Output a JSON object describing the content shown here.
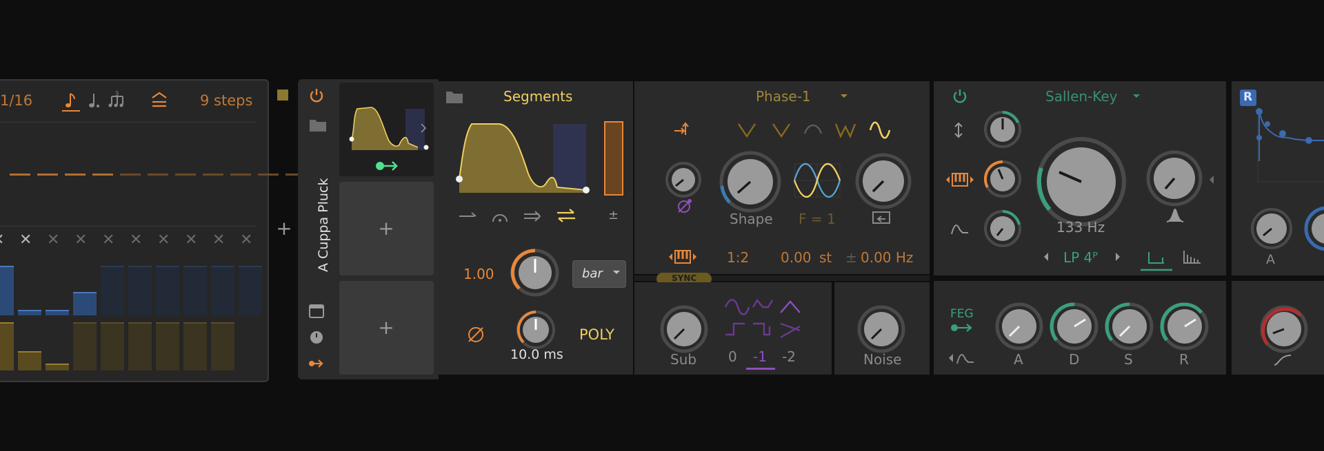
{
  "sequencer": {
    "rate": "1/16",
    "steps": "9 steps",
    "x_marks": [
      "✕",
      "✕",
      "✕",
      "✕",
      "✕",
      "✕",
      "✕",
      "✕",
      "✕",
      "✕"
    ]
  },
  "device_chain": {
    "add_label": "+",
    "device_name": "A Cuppa Pluck",
    "slot_add_1": "+",
    "slot_add_2": "+"
  },
  "segments": {
    "title": "Segments",
    "amount": "1.00",
    "mode": "bar",
    "time": "10.0 ms",
    "poly": "POLY",
    "bipolar": "±"
  },
  "phase1": {
    "title": "Phase-1",
    "shape_label": "Shape",
    "f_label": "F = 1",
    "ratio": "1:2",
    "semitones": "0.00",
    "st_unit": "st",
    "pm": "±",
    "hz": "0.00 Hz",
    "sync": "SYNC",
    "sub_label": "Sub",
    "oct": [
      "0",
      "-1",
      "-2"
    ],
    "noise_label": "Noise"
  },
  "filter": {
    "title": "Sallen-Key",
    "cutoff": "133 Hz",
    "mode": "LP 4ᴾ"
  },
  "feg": {
    "label": "FEG",
    "adsr": [
      "A",
      "D",
      "S",
      "R"
    ]
  },
  "right": {
    "badge": "R",
    "a_label": "A"
  },
  "colors": {
    "orange": "#e8883a",
    "yellow": "#f0d060",
    "green": "#3aa07a",
    "purple": "#8e4fc0",
    "blue": "#3a5a90"
  }
}
